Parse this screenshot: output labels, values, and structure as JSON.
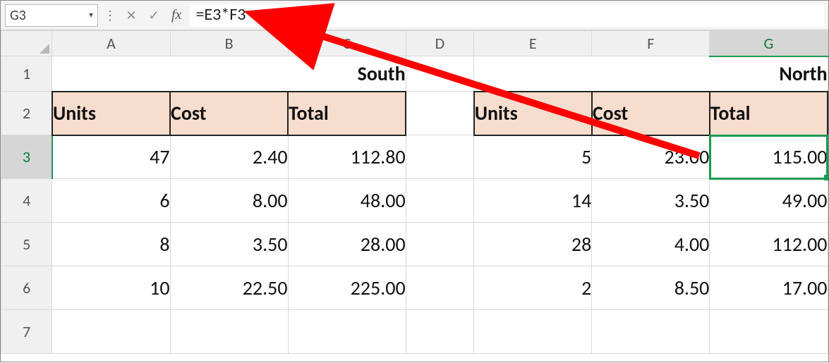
{
  "nameBox": {
    "value": "G3"
  },
  "formulaBar": {
    "fx": "fx",
    "value": "=E3*F3"
  },
  "columns": [
    "A",
    "B",
    "C",
    "D",
    "E",
    "F",
    "G"
  ],
  "rows": [
    "1",
    "2",
    "3",
    "4",
    "5",
    "6",
    "7"
  ],
  "activeCell": {
    "col": "G",
    "row": "3"
  },
  "regions": {
    "south": {
      "title": "South",
      "headers": {
        "units": "Units",
        "cost": "Cost",
        "total": "Total"
      }
    },
    "north": {
      "title": "North",
      "headers": {
        "units": "Units",
        "cost": "Cost",
        "total": "Total"
      }
    }
  },
  "south_data": [
    {
      "units": "47",
      "cost": "2.40",
      "total": "112.80"
    },
    {
      "units": "6",
      "cost": "8.00",
      "total": "48.00"
    },
    {
      "units": "8",
      "cost": "3.50",
      "total": "28.00"
    },
    {
      "units": "10",
      "cost": "22.50",
      "total": "225.00"
    }
  ],
  "north_data": [
    {
      "units": "5",
      "cost": "23.00",
      "total": "115.00"
    },
    {
      "units": "14",
      "cost": "3.50",
      "total": "49.00"
    },
    {
      "units": "28",
      "cost": "4.00",
      "total": "112.00"
    },
    {
      "units": "2",
      "cost": "8.50",
      "total": "17.00"
    }
  ],
  "annotation": {
    "type": "arrow",
    "color": "#ff0000",
    "from": "cell G3",
    "to": "formula bar"
  }
}
